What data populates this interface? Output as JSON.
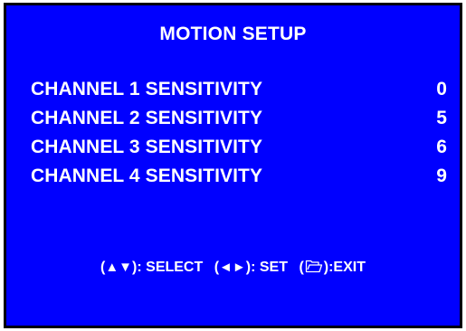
{
  "menu": {
    "title": "MOTION SETUP",
    "settings": [
      {
        "label": "CHANNEL 1 SENSITIVITY",
        "value": "0"
      },
      {
        "label": "CHANNEL 2 SENSITIVITY",
        "value": "5"
      },
      {
        "label": "CHANNEL 3 SENSITIVITY",
        "value": "6"
      },
      {
        "label": "CHANNEL 4 SENSITIVITY",
        "value": "9"
      }
    ]
  },
  "help": {
    "select_keys": "▲▼",
    "select_label": "SELECT",
    "set_keys": "◄►",
    "set_label": "SET",
    "exit_icon": "folder-icon",
    "exit_label": "EXIT"
  },
  "colors": {
    "background": "#0000ff",
    "text": "#ffffff",
    "border": "#000000"
  }
}
